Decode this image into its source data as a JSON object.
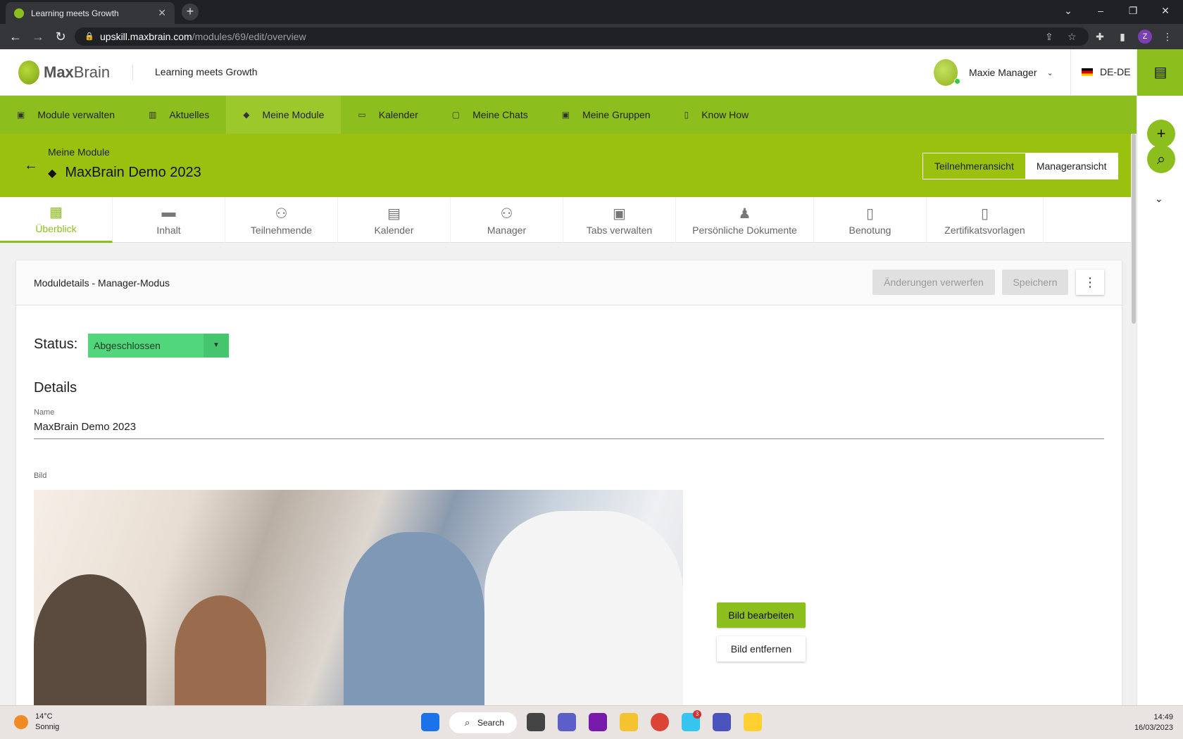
{
  "browser": {
    "tab_title": "Learning meets Growth",
    "url_host": "upskill.maxbrain.com",
    "url_path": "/modules/69/edit/overview",
    "profile_initial": "Z"
  },
  "header": {
    "logo_bold": "Max",
    "logo_light": "Brain",
    "tagline": "Learning meets Growth",
    "user_name": "Maxie Manager",
    "language": "DE-DE"
  },
  "mainnav": {
    "items": [
      {
        "label": "Module verwalten",
        "icon": "folder-person-icon"
      },
      {
        "label": "Aktuelles",
        "icon": "books-icon"
      },
      {
        "label": "Meine Module",
        "icon": "graduation-cap-icon"
      },
      {
        "label": "Kalender",
        "icon": "calendar-icon"
      },
      {
        "label": "Meine Chats",
        "icon": "chat-icon"
      },
      {
        "label": "Meine Gruppen",
        "icon": "folder-group-icon"
      },
      {
        "label": "Know How",
        "icon": "book-open-icon"
      }
    ]
  },
  "module": {
    "breadcrumb": "Meine Module",
    "title": "MaxBrain Demo 2023",
    "view_participant": "Teilnehmeransicht",
    "view_manager": "Manageransicht"
  },
  "subtabs": {
    "items": [
      {
        "label": "Überblick",
        "icon": "dashboard-icon"
      },
      {
        "label": "Inhalt",
        "icon": "folder-icon"
      },
      {
        "label": "Teilnehmende",
        "icon": "people-icon"
      },
      {
        "label": "Kalender",
        "icon": "calendar-icon"
      },
      {
        "label": "Manager",
        "icon": "people-icon"
      },
      {
        "label": "Tabs verwalten",
        "icon": "window-icon"
      },
      {
        "label": "Persönliche Dokumente",
        "icon": "person-doc-icon"
      },
      {
        "label": "Benotung",
        "icon": "grade-doc-icon"
      },
      {
        "label": "Zertifikatsvorlagen",
        "icon": "cert-doc-icon"
      }
    ]
  },
  "card": {
    "title": "Moduldetails - Manager-Modus",
    "discard_label": "Änderungen verwerfen",
    "save_label": "Speichern",
    "status_label": "Status:",
    "status_value": "Abgeschlossen",
    "details_heading": "Details",
    "name_label": "Name",
    "name_value": "MaxBrain Demo 2023",
    "image_label": "Bild",
    "edit_image": "Bild bearbeiten",
    "remove_image": "Bild entfernen"
  },
  "taskbar": {
    "temp": "14°C",
    "weather": "Sonnig",
    "search": "Search",
    "slack_badge": "3",
    "time": "14:49",
    "date": "16/03/2023"
  },
  "colors": {
    "brand_green": "#8cbf1e",
    "status_green": "#52d67c"
  }
}
